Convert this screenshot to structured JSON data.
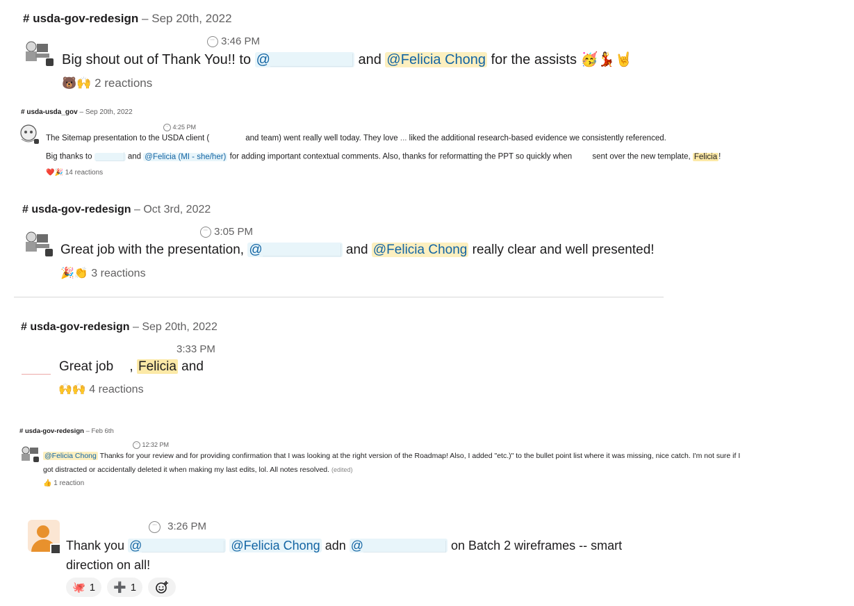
{
  "msg1": {
    "header": {
      "hash": "#",
      "channel": "usda-gov-redesign",
      "sep": "–",
      "date": "Sep 20th, 2022"
    },
    "time": "3:46 PM",
    "text": {
      "pre": "Big shout out of Thank You!! to ",
      "mention_at": "@",
      "mid": " and ",
      "mention": "@Felicia Chong",
      "post": " for the assists "
    },
    "emojis": "🥳💃🤘",
    "reaction_emojis": "🐻🙌",
    "reactions": "2 reactions"
  },
  "msg2": {
    "header": {
      "hash": "#",
      "channel": "usda-usda_gov",
      "sep": "–",
      "date": "Sep 20th, 2022"
    },
    "time": "4:25 PM",
    "line1": {
      "a": "The Sitemap presentation to the USDA client (",
      "b": "and team) went really well today. They love ",
      "ellipsis": "...",
      "c": " liked the additional research-based evidence we consistently referenced."
    },
    "line2": {
      "a": "Big thanks to ",
      "b": " and ",
      "mention": "@Felicia (MI - she/her)",
      "c": " for adding important contextual comments. Also, thanks for reformatting the PPT so quickly when ",
      "d": "sent over the new template, ",
      "name": "Felicia",
      "e": "!"
    },
    "reaction_emojis": "❤️🎉",
    "reactions": "14 reactions"
  },
  "msg3": {
    "header": {
      "hash": "#",
      "channel": "usda-gov-redesign",
      "sep": "–",
      "date": "Oct 3rd, 2022"
    },
    "time": "3:05 PM",
    "text": {
      "pre": "Great job with the presentation, ",
      "mention_at": "@",
      "mid": " and ",
      "mention": "@Felicia Chong",
      "post": " really clear and well presented!"
    },
    "reaction_emojis": "🎉👏",
    "reactions": "3 reactions"
  },
  "msg4": {
    "header": {
      "hash": "#",
      "channel": "usda-gov-redesign",
      "sep": "–",
      "date": "Sep 20th, 2022"
    },
    "time": "3:33 PM",
    "text": {
      "pre": "Great job",
      "comma": " , ",
      "name": "Felicia",
      "post": " and"
    },
    "reaction_emojis": "🙌🙌",
    "reactions": "4 reactions"
  },
  "msg5": {
    "header": {
      "hash": "#",
      "channel": "usda-gov-redesign",
      "sep": "–",
      "date": "Feb 6th"
    },
    "time": "12:32 PM",
    "line1": {
      "mention": "@Felicia Chong",
      "text": " Thanks for your review and for providing confirmation that I was looking at the right version of the Roadmap! Also, I added \"etc.)\" to the bullet point list where it was missing, nice catch. I'm not sure if I"
    },
    "line2": {
      "text": "got distracted or accidentally deleted it when making my last edits, lol. All notes resolved. ",
      "edited": "(edited)"
    },
    "reaction_emojis": "👍",
    "reactions": "1 reaction"
  },
  "msg6": {
    "time": "3:26 PM",
    "line1": {
      "pre": "Thank you ",
      "mention_at1": "@",
      "mention": "@Felicia Chong",
      "mid": " adn ",
      "mention_at2": "@",
      "post": " on Batch 2 wireframes -- smart"
    },
    "line2": "direction on all!",
    "chips": [
      {
        "emoji": "🐙",
        "count": "1"
      },
      {
        "emoji": "➕",
        "count": "1"
      }
    ],
    "add_reaction_icon": "add-reaction-icon"
  }
}
